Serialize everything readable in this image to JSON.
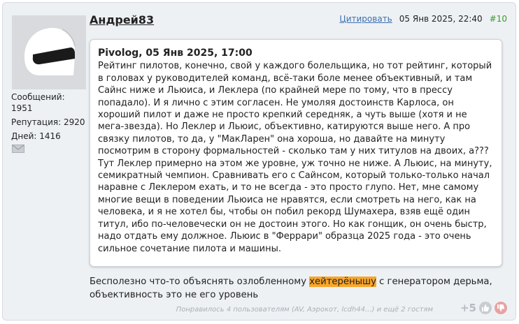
{
  "post": {
    "author": "Андрей83",
    "quote_action": "Цитировать",
    "datetime": "05 Янв 2025, 22:40",
    "number": "#10"
  },
  "profile": {
    "messages_label": "Сообщений:",
    "messages_value": "1951",
    "reputation": "Репутация: 2920",
    "days": "Дней: 1416"
  },
  "quote": {
    "header": "Pivolog, 05 Янв 2025, 17:00",
    "text": "Рейтинг пилотов, конечно, свой у каждого болельщика, но тот рейтинг, который\nв головах у руководителей команд, всё-таки боле менее объективный, и там\nСайнс ниже и Льюиса, и Леклера (по крайней мере по тому, что в прессу\nпопадало). И я лично с этим согласен. Не умоляя достоинств Карлоса, он\nхороший пилот и даже не просто крепкий середняк, а чуть выше (хотя и не\nмега-звезда). Но Леклер и Льюис, объективно, катируются выше него. А про\nсвязку пилотов, то да, у \"МакЛарен\" она хороша, но давайте на минуту\nпосмотрим в сторону формальностей - сколько там у них титулов на двоих, а???\nТут Леклер примерно на этом же уровне, уж точно не ниже. А Льюис, на минуту,\nсемикратный чемпион. Сравнивать его с Сайнсом, который только-только начал\nнаравне с Леклером ехать, и то не всегда - это просто глупо. Нет, мне самому\nмногие вещи в поведении Льюиса не нравятся, если смотреть на него, как на\nчеловека, и я не хотел бы, чтобы он побил рекорд Шумахера, взяв ещё один\nтитул, ибо по-человечески он не достоин этого. Но как гонщик, он очень быстр,\nнадо отдать ему должное. Льюис в \"Феррари\" образца 2025 года - это очень\nсильное сочетание пилота и машины."
  },
  "reply": {
    "before": "Бесполезно что-то объяснять озлобленному ",
    "highlight": "хейтерёнышу",
    "after": " с генератором дерьма,",
    "line2": "объективность это не его уровень"
  },
  "footer": {
    "likes": "Понравилось 4 пользователям (AV, Аэрокот, lcdh44...) и ещё 2 гостям",
    "score": "+5"
  },
  "colors": {
    "highlight": "#f9a62a",
    "vote_up": "#c8cdd2",
    "vote_down": "#e8a2a2"
  },
  "icons": {
    "avatar": "helmet-avatar",
    "message": "envelope-icon",
    "like": "thumb-up-icon",
    "dislike": "thumb-down-icon"
  }
}
